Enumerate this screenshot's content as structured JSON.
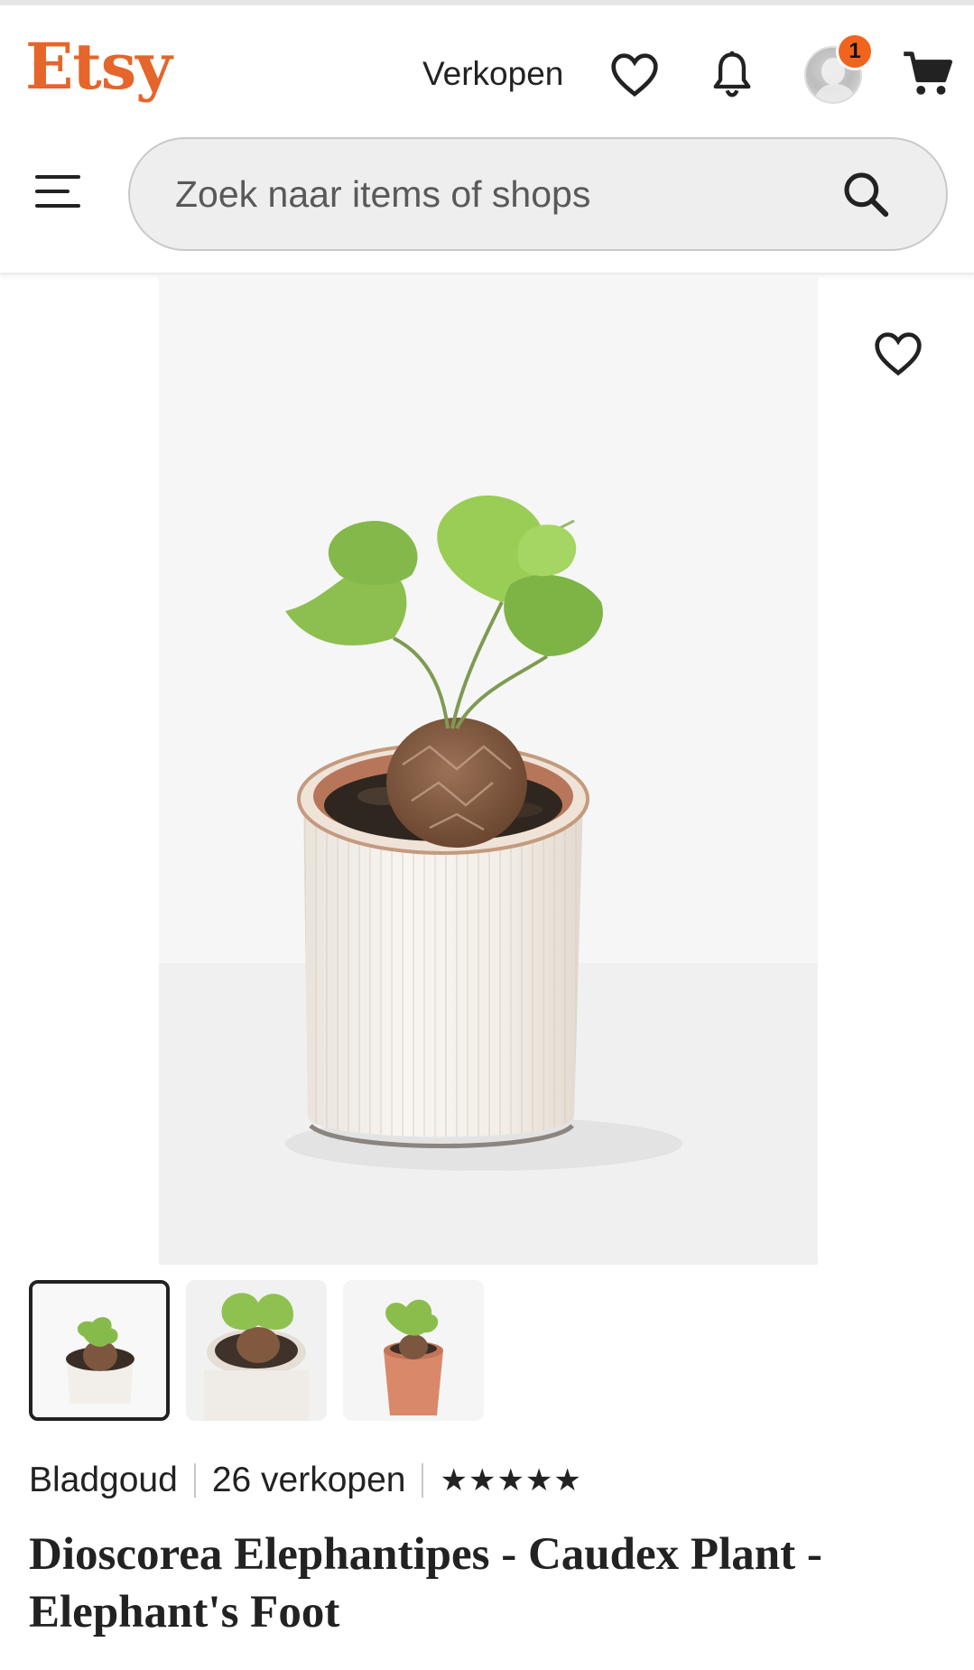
{
  "header": {
    "logo": "Etsy",
    "sell_label": "Verkopen",
    "notification_badge": "1",
    "icons": [
      "heart-icon",
      "bell-icon",
      "avatar",
      "cart-icon",
      "hamburger-menu-icon",
      "search-icon"
    ]
  },
  "search": {
    "placeholder": "Zoek naar items of shops"
  },
  "listing": {
    "thumbnails": [
      "thumbnail-1",
      "thumbnail-2",
      "thumbnail-3"
    ],
    "active_thumbnail": 0,
    "shop_name": "Bladgoud",
    "sales": "26 verkopen",
    "rating_stars": "★★★★★",
    "rating": 5,
    "title": "Dioscorea Elephantipes - Caudex Plant - Elephant's Foot"
  },
  "colors": {
    "brand": "#e5652a",
    "badge": "#f1641e",
    "text": "#222222"
  }
}
